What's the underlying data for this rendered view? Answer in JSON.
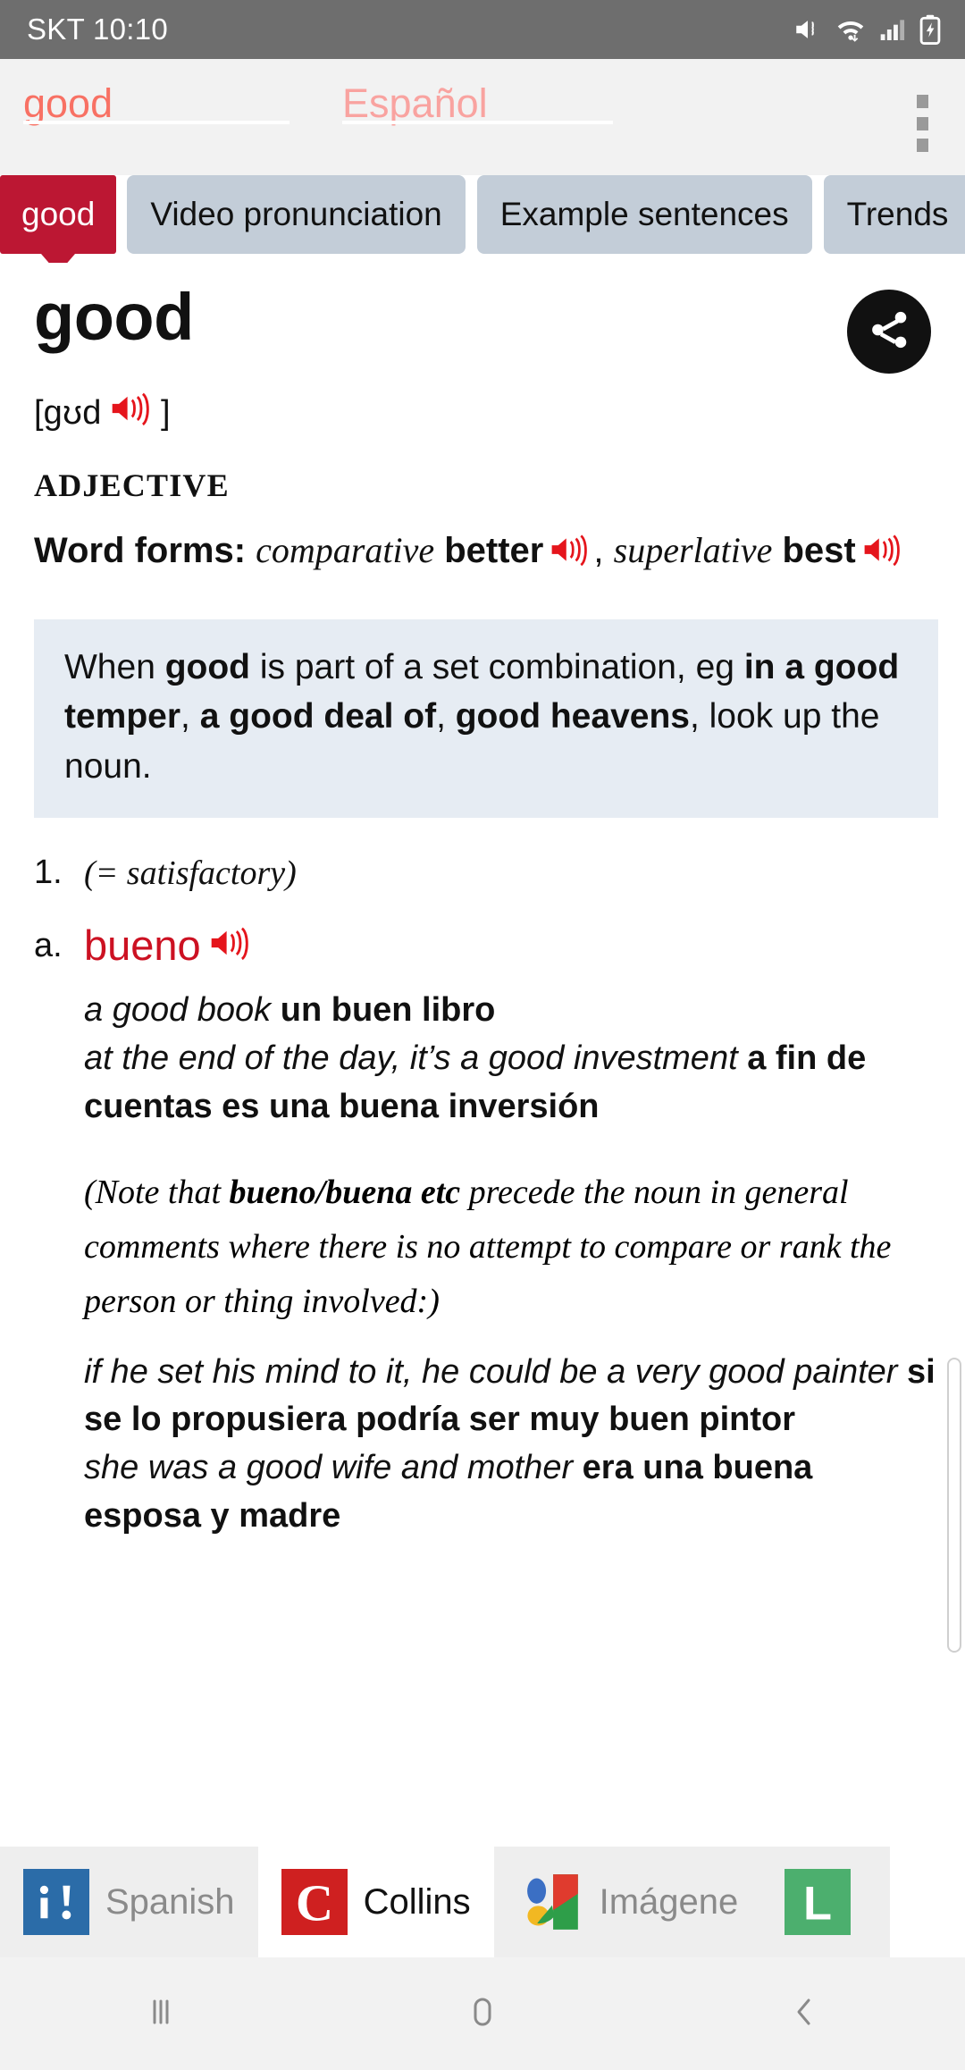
{
  "status_bar": {
    "carrier_time": "SKT 10:10",
    "icons": [
      "mute-vibrate-icon",
      "wifi-icon",
      "signal-icon",
      "battery-charging-icon"
    ]
  },
  "search_bar": {
    "source_value": "good",
    "target_value": "Español",
    "overflow_label": "overflow-menu"
  },
  "tabs": [
    {
      "label": "good",
      "active": true
    },
    {
      "label": "Video pronunciation",
      "active": false
    },
    {
      "label": "Example sentences",
      "active": false
    },
    {
      "label": "Trends",
      "active": false
    }
  ],
  "entry": {
    "headword": "good",
    "share_icon": "share-icon",
    "pronunciation": {
      "open": "[",
      "ipa": "ɡʊd",
      "close": "]",
      "audio_icon": "speaker-icon"
    },
    "part_of_speech": "ADJECTIVE",
    "word_forms": {
      "label": "Word forms:",
      "comparative_label": "comparative",
      "comparative": "better",
      "separator": ",",
      "superlative_label": "superlative",
      "superlative": "best"
    },
    "note_box": {
      "seg1": "When ",
      "bold1": "good",
      "seg2": " is part of a set combination, eg ",
      "bold2": "in a good temper",
      "seg3": ", ",
      "bold3": "a good deal of",
      "seg4": ", ",
      "bold4": "good heavens",
      "seg5": ", look up the noun."
    },
    "senses": [
      {
        "number": "1.",
        "gloss": "(= satisfactory)",
        "subsenses": [
          {
            "letter": "a.",
            "translation": "bueno",
            "audio_icon": "speaker-icon",
            "examples": [
              {
                "en": "a good book ",
                "es": "un buen libro"
              },
              {
                "en": "at the end of the day, it’s a good investment ",
                "es": "a fin de cuentas es una buena inversión"
              }
            ],
            "note": {
              "seg1": "(Note that ",
              "bold1": "bueno/buena etc",
              "seg2": " precede the noun in general comments where there is no attempt to compare or rank the person or thing involved:)"
            },
            "examples2": [
              {
                "en": "if he set his mind to it, he could be a very good painter ",
                "es": "si se lo propusiera podría ser muy buen pintor"
              },
              {
                "en": "she was a good wife and mother ",
                "es": "era una buena esposa y madre"
              }
            ]
          }
        ]
      }
    ]
  },
  "app_tabs": [
    {
      "label": "Spanish",
      "icon": "spanish-dict-icon",
      "active": false
    },
    {
      "label": "Collins",
      "icon": "collins-icon",
      "active": true
    },
    {
      "label": "Imágene",
      "icon": "google-images-icon",
      "active": false
    },
    {
      "label": "",
      "icon": "linguee-icon",
      "active": false
    }
  ],
  "nav_bar": {
    "recents_label": "recents-icon",
    "home_label": "home-icon",
    "back_label": "back-icon"
  },
  "colors": {
    "accent_red": "#bc1733",
    "translation_red": "#cc1122",
    "tab_inactive": "#c3cdd8",
    "note_bg": "#e6ecf3",
    "search_bg": "#f2f2f2",
    "status_bg": "#6e6e6e"
  }
}
